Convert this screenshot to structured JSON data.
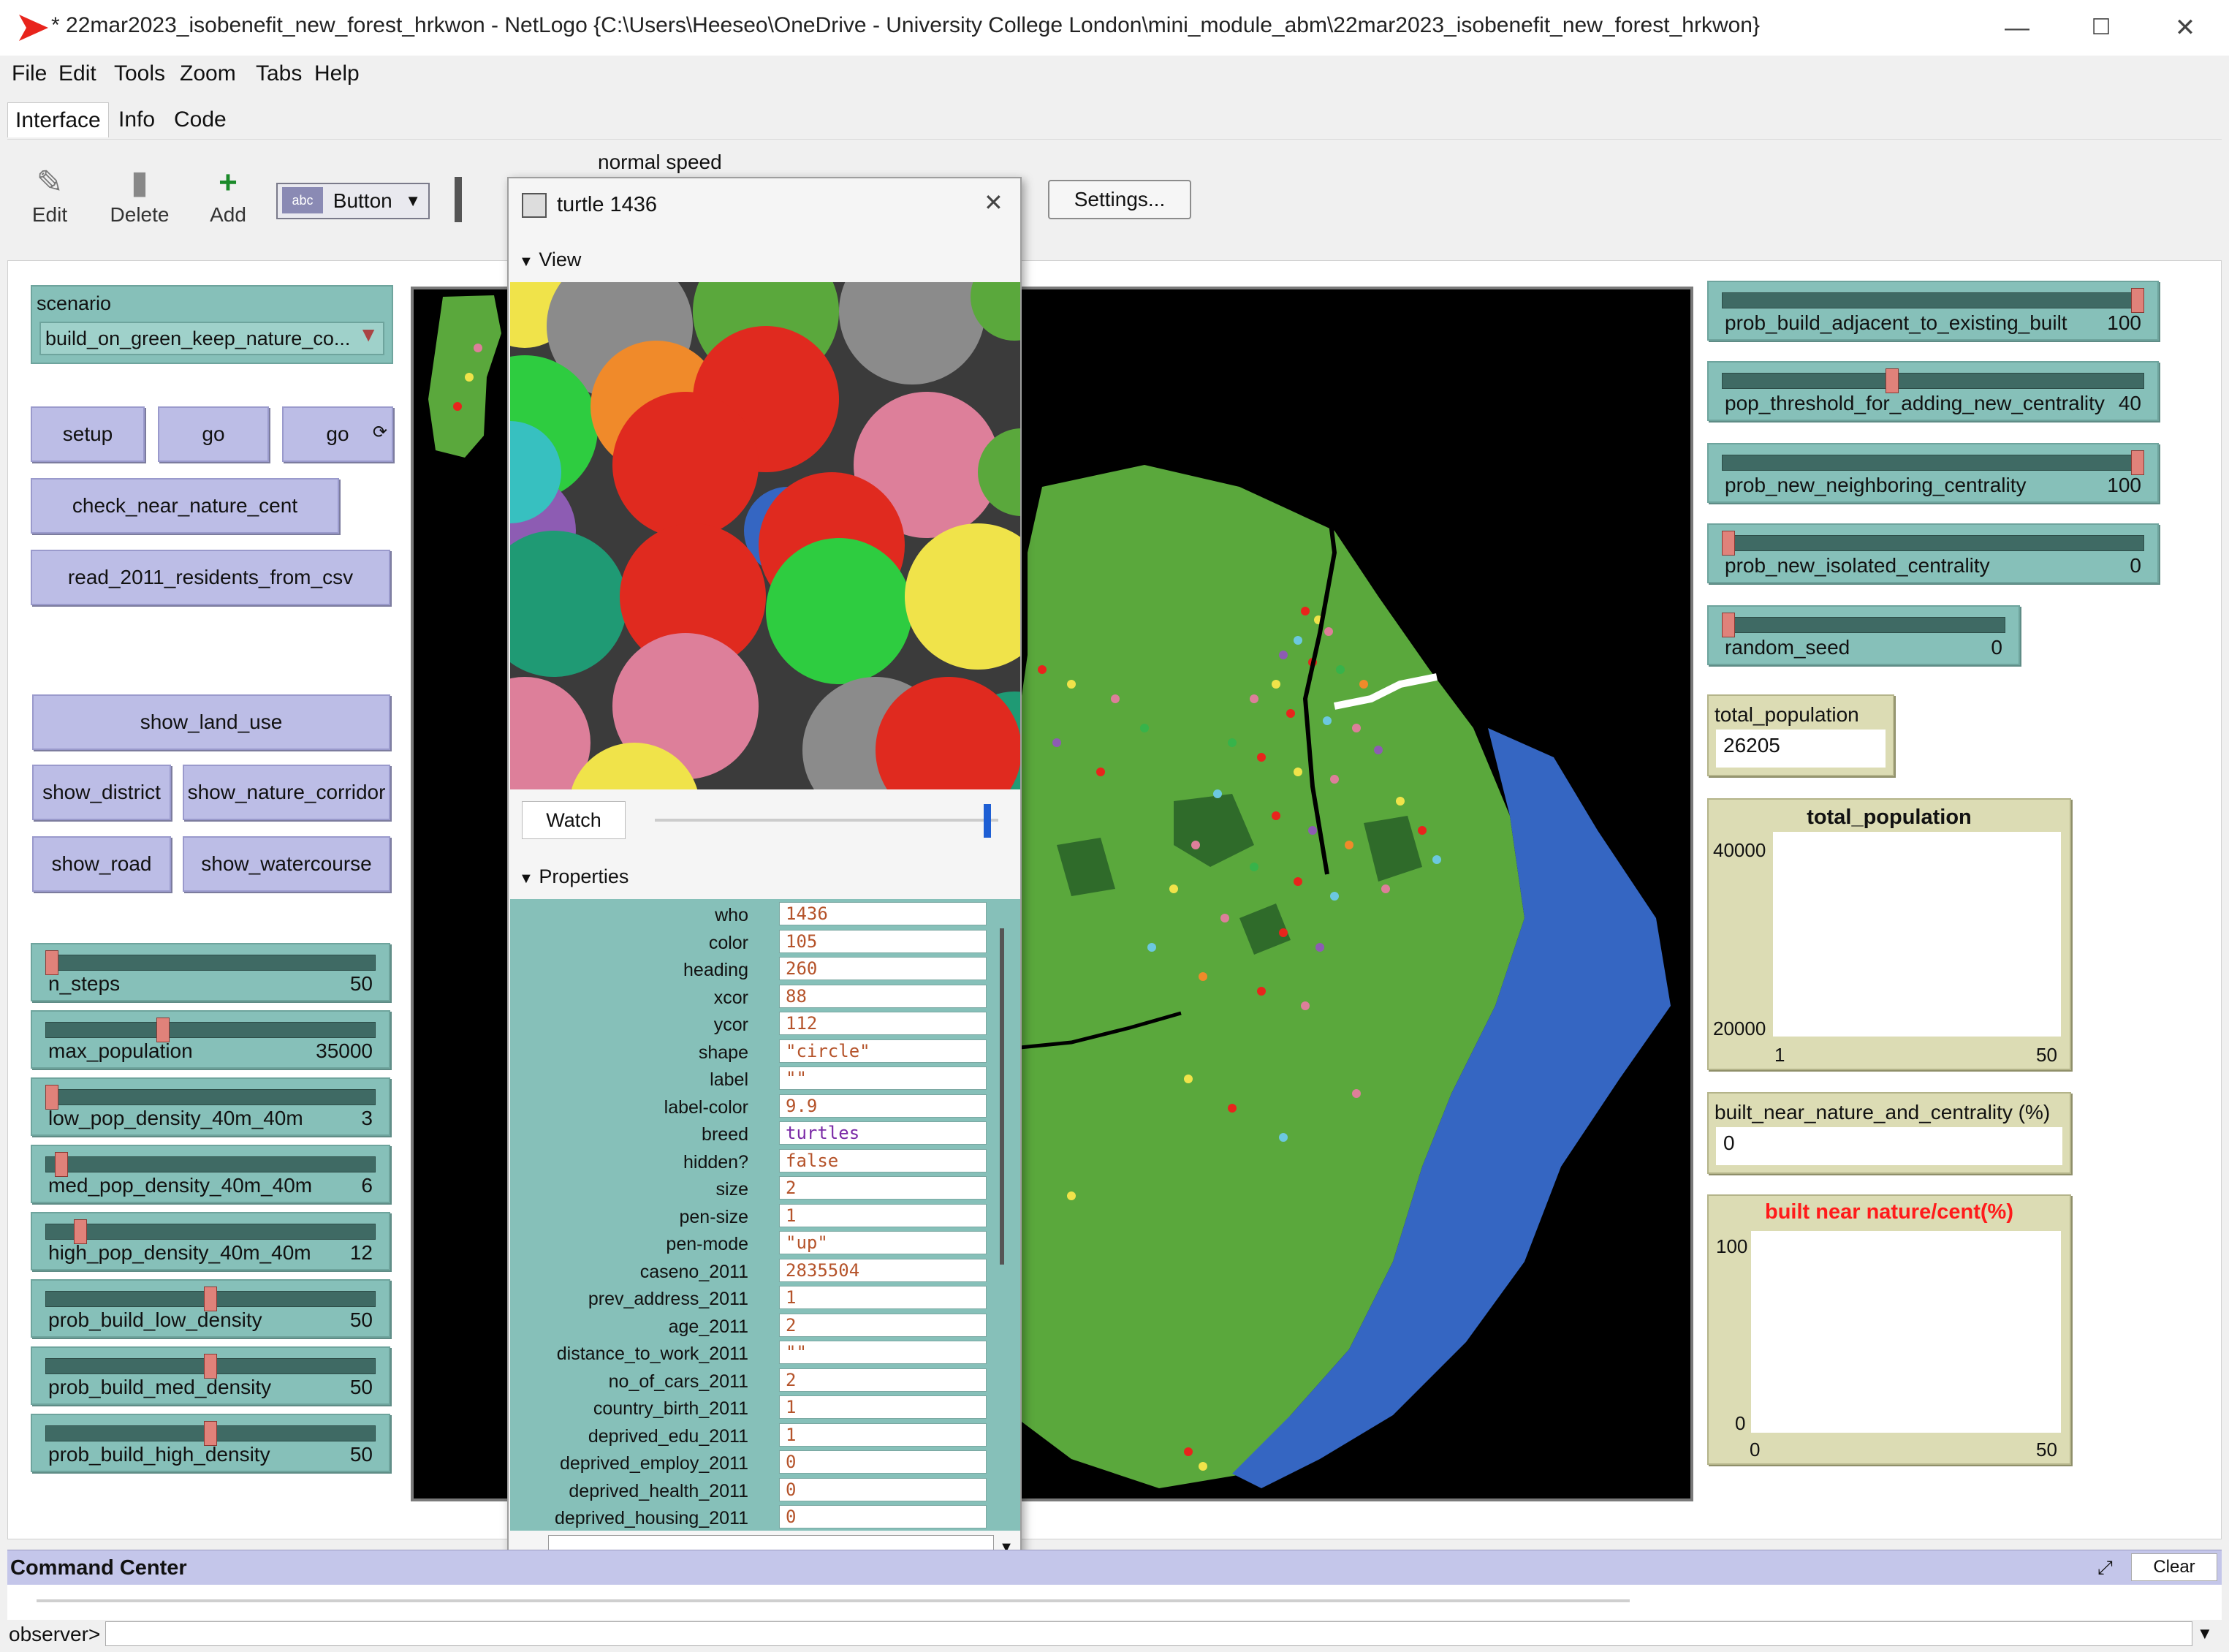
{
  "window": {
    "title": "* 22mar2023_isobenefit_new_forest_hrkwon - NetLogo {C:\\Users\\Heeseo\\OneDrive - University College London\\mini_module_abm\\22mar2023_isobenefit_new_forest_hrkwon}",
    "minimize": "—",
    "maximize": "☐",
    "close": "✕"
  },
  "menu": [
    "File",
    "Edit",
    "Tools",
    "Zoom",
    "Tabs",
    "Help"
  ],
  "tabs": [
    "Interface",
    "Info",
    "Code"
  ],
  "toolbar": {
    "edit": "Edit",
    "delete": "Delete",
    "add": "Add",
    "widget_type": "Button",
    "speed_label": "normal speed",
    "settings": "Settings..."
  },
  "chooser": {
    "label": "scenario",
    "value": "build_on_green_keep_nature_co..."
  },
  "buttons": {
    "setup": "setup",
    "go": "go",
    "go_forever": "go",
    "check_near_nature_cent": "check_near_nature_cent",
    "read_csv": "read_2011_residents_from_csv",
    "show_land_use": "show_land_use",
    "show_district": "show_district",
    "show_nature_corridor": "show_nature_corridor",
    "show_road": "show_road",
    "show_watercourse": "show_watercourse"
  },
  "sliders_left": [
    {
      "name": "n_steps",
      "value": "50",
      "fraction": 0.0
    },
    {
      "name": "max_population",
      "value": "35000",
      "fraction": 0.35
    },
    {
      "name": "low_pop_density_40m_40m",
      "value": "3",
      "fraction": 0.0
    },
    {
      "name": "med_pop_density_40m_40m",
      "value": "6",
      "fraction": 0.03
    },
    {
      "name": "high_pop_density_40m_40m",
      "value": "12",
      "fraction": 0.09
    },
    {
      "name": "prob_build_low_density",
      "value": "50",
      "fraction": 0.5
    },
    {
      "name": "prob_build_med_density",
      "value": "50",
      "fraction": 0.5
    },
    {
      "name": "prob_build_high_density",
      "value": "50",
      "fraction": 0.5
    }
  ],
  "sliders_right": [
    {
      "name": "prob_build_adjacent_to_existing_built",
      "value": "100",
      "fraction": 1.0
    },
    {
      "name": "pop_threshold_for_adding_new_centrality",
      "value": "40",
      "fraction": 0.4
    },
    {
      "name": "prob_new_neighboring_centrality",
      "value": "100",
      "fraction": 1.0
    },
    {
      "name": "prob_new_isolated_centrality",
      "value": "0",
      "fraction": 0.0
    },
    {
      "name": "random_seed",
      "value": "0",
      "fraction": 0.0
    }
  ],
  "monitors": {
    "total_population": {
      "label": "total_population",
      "value": "26205"
    },
    "built_near": {
      "label": "built_near_nature_and_centrality (%)",
      "value": "0"
    }
  },
  "plots": {
    "pop": {
      "title": "total_population",
      "ymax": "40000",
      "ymin": "20000",
      "xmin": "1",
      "xmax": "50"
    },
    "built": {
      "title": "built near nature/cent(%)",
      "ymax": "100",
      "ymin": "0",
      "xmin": "0",
      "xmax": "50",
      "title_color": "#ff1a1a"
    }
  },
  "inspector": {
    "title": "turtle 1436",
    "close": "✕",
    "view_section": "View",
    "watch": "Watch",
    "properties_section": "Properties",
    "properties": [
      {
        "name": "who",
        "value": "1436"
      },
      {
        "name": "color",
        "value": "105"
      },
      {
        "name": "heading",
        "value": "260"
      },
      {
        "name": "xcor",
        "value": "88"
      },
      {
        "name": "ycor",
        "value": "112"
      },
      {
        "name": "shape",
        "value": "\"circle\""
      },
      {
        "name": "label",
        "value": "\"\""
      },
      {
        "name": "label-color",
        "value": "9.9"
      },
      {
        "name": "breed",
        "value": "turtles"
      },
      {
        "name": "hidden?",
        "value": "false"
      },
      {
        "name": "size",
        "value": "2"
      },
      {
        "name": "pen-size",
        "value": "1"
      },
      {
        "name": "pen-mode",
        "value": "\"up\""
      },
      {
        "name": "caseno_2011",
        "value": "2835504"
      },
      {
        "name": "prev_address_2011",
        "value": "1"
      },
      {
        "name": "age_2011",
        "value": "2"
      },
      {
        "name": "distance_to_work_2011",
        "value": "\"\""
      },
      {
        "name": "no_of_cars_2011",
        "value": "2"
      },
      {
        "name": "country_birth_2011",
        "value": "1"
      },
      {
        "name": "deprived_edu_2011",
        "value": "1"
      },
      {
        "name": "deprived_employ_2011",
        "value": "0"
      },
      {
        "name": "deprived_health_2011",
        "value": "0"
      },
      {
        "name": "deprived_housing_2011",
        "value": "0"
      }
    ]
  },
  "command_center": {
    "title": "Command Center",
    "clear": "Clear",
    "prompt": "observer>"
  },
  "colors": {
    "button_bg": "#bcbde6",
    "slider_bg": "#86c0b9",
    "monitor_bg": "#dcdcb4",
    "land_green": "#5aa83c",
    "water_blue": "#3566c2",
    "dark_green": "#2f6b2a",
    "netlogo_red": "#e8241c"
  }
}
